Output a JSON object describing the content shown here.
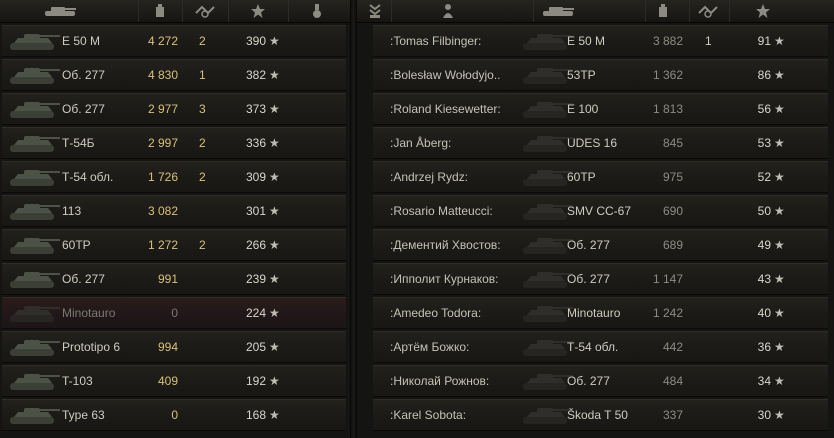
{
  "header": {
    "left_icons": [
      "tank-icon",
      "damage-icon",
      "frags-icon",
      "xp-star-icon",
      "medal-icon"
    ],
    "right_icons": [
      "rank-icon",
      "player-icon",
      "tank-icon",
      "damage-icon",
      "frags-icon",
      "xp-star-icon"
    ]
  },
  "colors": {
    "accent_gold": "#d8c077",
    "dead_row": "#2a1c19",
    "alive_row": "#23211c"
  },
  "star_symbol": "★",
  "left_team": [
    {
      "vehicle": "E 50 M",
      "damage": "4 272",
      "kills": "2",
      "xp": "390",
      "dead": false
    },
    {
      "vehicle": "Об. 277",
      "damage": "4 830",
      "kills": "1",
      "xp": "382",
      "dead": false
    },
    {
      "vehicle": "Об. 277",
      "damage": "2 977",
      "kills": "3",
      "xp": "373",
      "dead": false
    },
    {
      "vehicle": "Т-54Б",
      "damage": "2 997",
      "kills": "2",
      "xp": "336",
      "dead": false
    },
    {
      "vehicle": "Т-54 обл.",
      "damage": "1 726",
      "kills": "2",
      "xp": "309",
      "dead": false
    },
    {
      "vehicle": "113",
      "damage": "3 082",
      "kills": "",
      "xp": "301",
      "dead": false
    },
    {
      "vehicle": "60TP",
      "damage": "1 272",
      "kills": "2",
      "xp": "266",
      "dead": false
    },
    {
      "vehicle": "Об. 277",
      "damage": "991",
      "kills": "",
      "xp": "239",
      "dead": false
    },
    {
      "vehicle": "Minotauro",
      "damage": "0",
      "kills": "",
      "xp": "224",
      "dead": true
    },
    {
      "vehicle": "Prototipo 6",
      "damage": "994",
      "kills": "",
      "xp": "205",
      "dead": false
    },
    {
      "vehicle": "T-103",
      "damage": "409",
      "kills": "",
      "xp": "192",
      "dead": false
    },
    {
      "vehicle": "Type 63",
      "damage": "0",
      "kills": "",
      "xp": "168",
      "dead": false
    }
  ],
  "right_team": [
    {
      "player": ":Tomas Filbinger:",
      "vehicle": "E 50 M",
      "damage": "3 882",
      "kills": "1",
      "xp": "91"
    },
    {
      "player": ":Bolesław Wołodyjo..",
      "vehicle": "53TP",
      "damage": "1 362",
      "kills": "",
      "xp": "86"
    },
    {
      "player": ":Roland Kiesewetter:",
      "vehicle": "E 100",
      "damage": "1 813",
      "kills": "",
      "xp": "56"
    },
    {
      "player": ":Jan Åberg:",
      "vehicle": "UDES 16",
      "damage": "845",
      "kills": "",
      "xp": "53"
    },
    {
      "player": ":Andrzej Rydz:",
      "vehicle": "60TP",
      "damage": "975",
      "kills": "",
      "xp": "52"
    },
    {
      "player": ":Rosario Matteucci:",
      "vehicle": "SMV CC-67",
      "damage": "690",
      "kills": "",
      "xp": "50"
    },
    {
      "player": ":Дементий Хвостов:",
      "vehicle": "Об. 277",
      "damage": "689",
      "kills": "",
      "xp": "49"
    },
    {
      "player": ":Ипполит Курнаков:",
      "vehicle": "Об. 277",
      "damage": "1 147",
      "kills": "",
      "xp": "43"
    },
    {
      "player": ":Amedeo Todora:",
      "vehicle": "Minotauro",
      "damage": "1 242",
      "kills": "",
      "xp": "40"
    },
    {
      "player": ":Артём Божко:",
      "vehicle": "Т-54 обл.",
      "damage": "442",
      "kills": "",
      "xp": "36"
    },
    {
      "player": ":Николай Рожнов:",
      "vehicle": "Об. 277",
      "damage": "484",
      "kills": "",
      "xp": "34"
    },
    {
      "player": ":Karel Sobota:",
      "vehicle": "Škoda T 50",
      "damage": "337",
      "kills": "",
      "xp": "30"
    }
  ]
}
